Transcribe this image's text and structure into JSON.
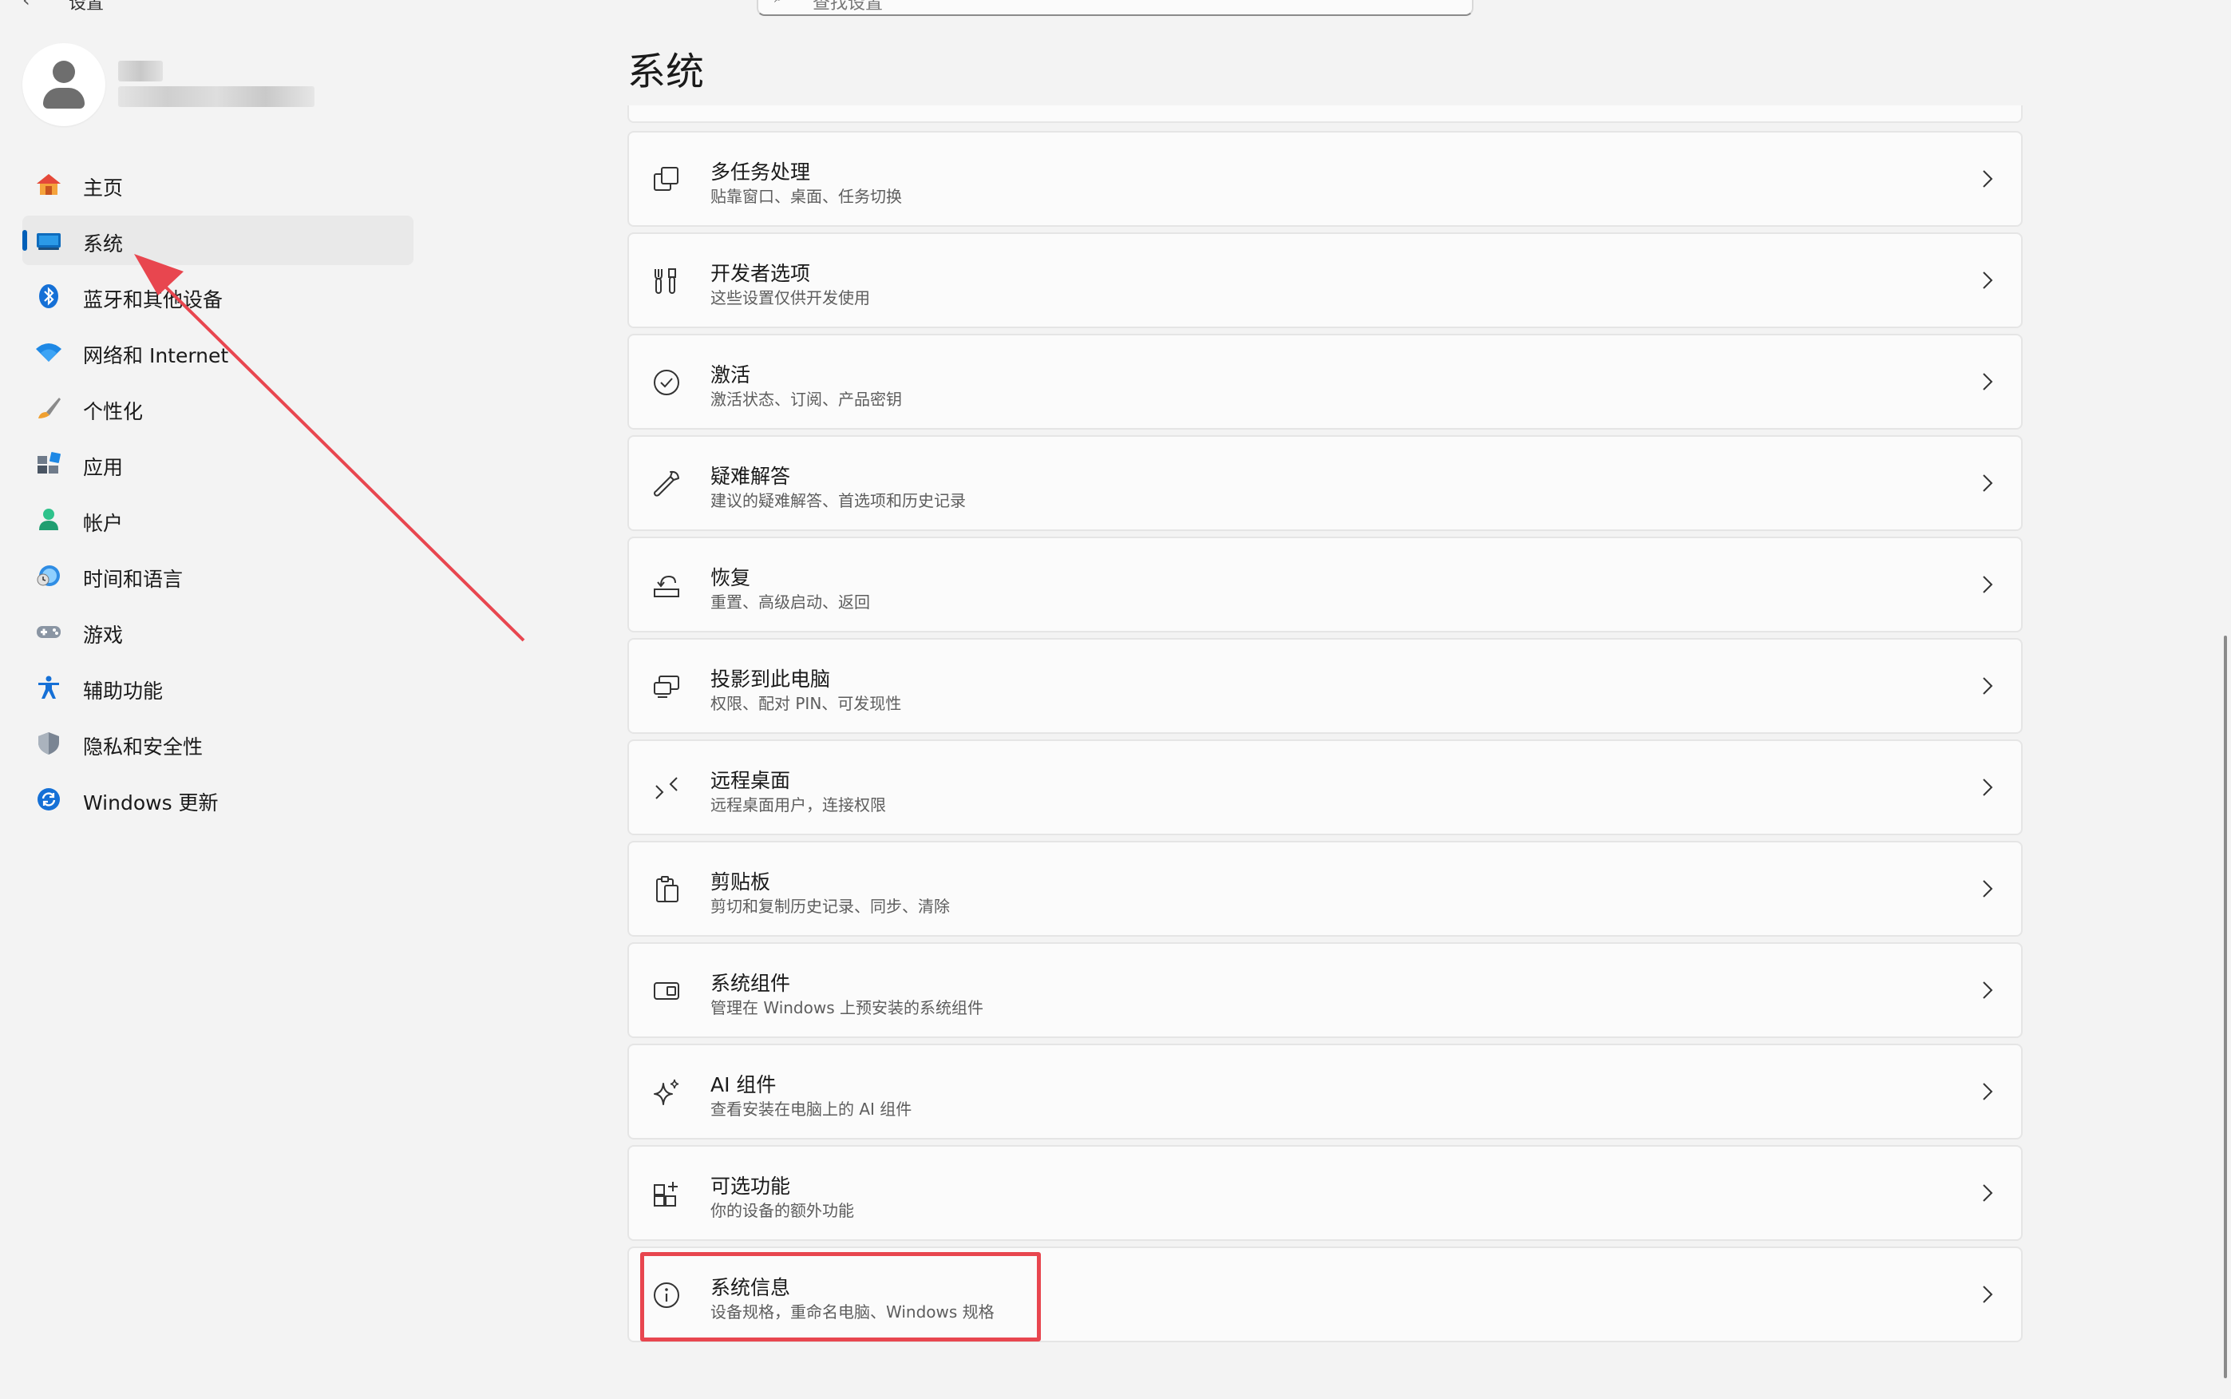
{
  "app": {
    "title": "设置",
    "search_placeholder": "查找设置"
  },
  "sidebar": {
    "items": [
      {
        "label": "主页",
        "icon": "home-icon"
      },
      {
        "label": "系统",
        "icon": "system-icon",
        "active": true
      },
      {
        "label": "蓝牙和其他设备",
        "icon": "bluetooth-icon"
      },
      {
        "label": "网络和 Internet",
        "icon": "wifi-icon"
      },
      {
        "label": "个性化",
        "icon": "brush-icon"
      },
      {
        "label": "应用",
        "icon": "apps-icon"
      },
      {
        "label": "帐户",
        "icon": "account-icon"
      },
      {
        "label": "时间和语言",
        "icon": "globe-clock-icon"
      },
      {
        "label": "游戏",
        "icon": "gamepad-icon"
      },
      {
        "label": "辅助功能",
        "icon": "accessibility-icon"
      },
      {
        "label": "隐私和安全性",
        "icon": "shield-icon"
      },
      {
        "label": "Windows 更新",
        "icon": "update-icon"
      }
    ]
  },
  "main": {
    "title": "系统",
    "cards": [
      {
        "title": "多任务处理",
        "subtitle": "贴靠窗口、桌面、任务切换",
        "icon": "multitasking-icon"
      },
      {
        "title": "开发者选项",
        "subtitle": "这些设置仅供开发使用",
        "icon": "developer-icon"
      },
      {
        "title": "激活",
        "subtitle": "激活状态、订阅、产品密钥",
        "icon": "activation-icon"
      },
      {
        "title": "疑难解答",
        "subtitle": "建议的疑难解答、首选项和历史记录",
        "icon": "wrench-icon"
      },
      {
        "title": "恢复",
        "subtitle": "重置、高级启动、返回",
        "icon": "recovery-icon"
      },
      {
        "title": "投影到此电脑",
        "subtitle": "权限、配对 PIN、可发现性",
        "icon": "projection-icon"
      },
      {
        "title": "远程桌面",
        "subtitle": "远程桌面用户，连接权限",
        "icon": "remote-desktop-icon"
      },
      {
        "title": "剪贴板",
        "subtitle": "剪切和复制历史记录、同步、清除",
        "icon": "clipboard-icon"
      },
      {
        "title": "系统组件",
        "subtitle": "管理在 Windows 上预安装的系统组件",
        "icon": "system-components-icon"
      },
      {
        "title": "AI 组件",
        "subtitle": "查看安装在电脑上的 AI 组件",
        "icon": "sparkle-icon"
      },
      {
        "title": "可选功能",
        "subtitle": "你的设备的额外功能",
        "icon": "optional-features-icon"
      },
      {
        "title": "系统信息",
        "subtitle": "设备规格，重命名电脑、Windows 规格",
        "icon": "info-icon"
      }
    ]
  },
  "colors": {
    "accent": "#005fb8",
    "annotation": "#e8464f"
  }
}
